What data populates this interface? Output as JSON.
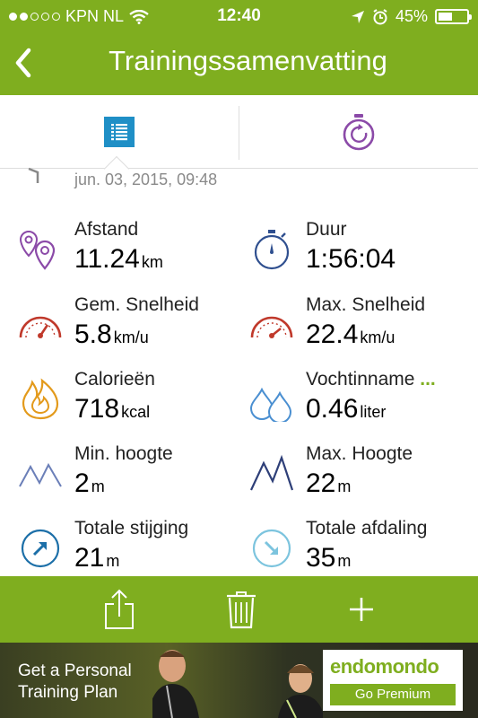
{
  "status_bar": {
    "carrier": "KPN NL",
    "time": "12:40",
    "battery": "45%"
  },
  "header": {
    "title": "Trainingssamenvatting"
  },
  "workout": {
    "date": "jun. 03, 2015, 09:48"
  },
  "stats": [
    {
      "label": "Afstand",
      "value": "11.24",
      "unit": "km",
      "icon": "location-pins-icon"
    },
    {
      "label": "Duur",
      "value": "1:56:04",
      "unit": "",
      "icon": "stopwatch-icon"
    },
    {
      "label": "Gem. Snelheid",
      "value": "5.8",
      "unit": "km/u",
      "icon": "speedometer-icon"
    },
    {
      "label": "Max. Snelheid",
      "value": "22.4",
      "unit": "km/u",
      "icon": "speedometer-icon"
    },
    {
      "label": "Calorieën",
      "value": "718",
      "unit": "kcal",
      "icon": "flame-icon"
    },
    {
      "label": "Vochtinname",
      "more": "...",
      "value": "0.46",
      "unit": "liter",
      "icon": "water-drops-icon"
    },
    {
      "label": "Min. hoogte",
      "value": "2",
      "unit": "m",
      "icon": "mountain-low-icon"
    },
    {
      "label": "Max. Hoogte",
      "value": "22",
      "unit": "m",
      "icon": "mountain-high-icon"
    },
    {
      "label": "Totale stijging",
      "value": "21",
      "unit": "m",
      "icon": "ascent-arrow-icon"
    },
    {
      "label": "Totale afdaling",
      "value": "35",
      "unit": "m",
      "icon": "descent-arrow-icon"
    }
  ],
  "ad": {
    "line1": "Get a Personal",
    "line2": "Training Plan",
    "brand": "endomondo",
    "cta": "Go Premium"
  },
  "colors": {
    "brand_green": "#7fae1f",
    "tab_blue": "#1f8fc6",
    "tab_purple": "#8b4aa8"
  }
}
